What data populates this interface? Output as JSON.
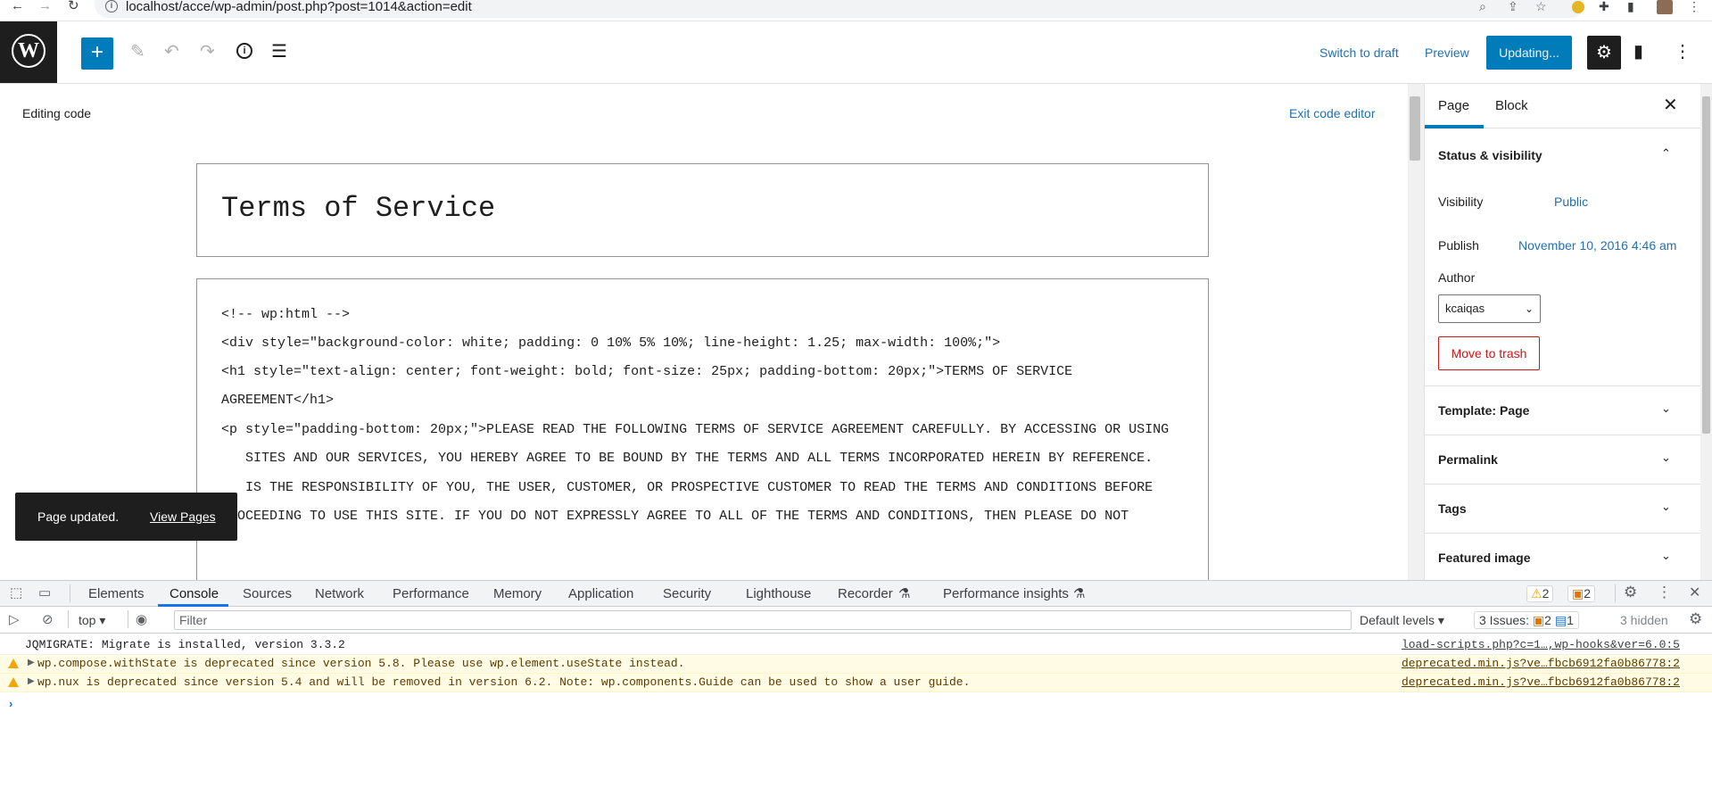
{
  "browser": {
    "url": "localhost/acce/wp-admin/post.php?post=1014&action=edit",
    "back_glyph": "←",
    "forward_glyph": "→",
    "reload_glyph": "↻",
    "info_glyph": "i",
    "zoom_glyph": "⌕",
    "share_glyph": "⇪",
    "star_glyph": "☆",
    "puzzle_glyph": "✚",
    "panel_glyph": "▮",
    "menu_glyph": "⋮"
  },
  "header": {
    "logo_glyph": "W",
    "add_glyph": "+",
    "edit_glyph": "✎",
    "undo_glyph": "↶",
    "redo_glyph": "↷",
    "info_glyph": "i",
    "outline_glyph": "☰",
    "switch_to_draft": "Switch to draft",
    "preview": "Preview",
    "update": "Updating...",
    "settings_glyph": "⚙",
    "plugin_glyph": "▮",
    "more_glyph": "⋮"
  },
  "editor": {
    "mode_label": "Editing code",
    "exit_label": "Exit code editor",
    "title": "Terms of Service",
    "code_lines": [
      "<!-- wp:html -->",
      "<div style=\"background-color: white; padding: 0 10% 5% 10%; line-height: 1.25; max-width: 100%;\">",
      "<h1 style=\"text-align: center; font-weight: bold; font-size: 25px; padding-bottom: 20px;\">TERMS OF SERVICE",
      "AGREEMENT</h1>",
      "<p style=\"padding-bottom: 20px;\">PLEASE READ THE FOLLOWING TERMS OF SERVICE AGREEMENT CAREFULLY. BY ACCESSING OR USING",
      "   SITES AND OUR SERVICES, YOU HEREBY AGREE TO BE BOUND BY THE TERMS AND ALL TERMS INCORPORATED HEREIN BY REFERENCE.",
      "   IS THE RESPONSIBILITY OF YOU, THE USER, CUSTOMER, OR PROSPECTIVE CUSTOMER TO READ THE TERMS AND CONDITIONS BEFORE",
      "PROCEEDING TO USE THIS SITE. IF YOU DO NOT EXPRESSLY AGREE TO ALL OF THE TERMS AND CONDITIONS, THEN PLEASE DO NOT"
    ]
  },
  "snackbar": {
    "message": "Page updated.",
    "link": "View Pages"
  },
  "sidebar": {
    "tabs": [
      "Page",
      "Block"
    ],
    "close_glyph": "✕",
    "status_section": "Status & visibility",
    "visibility_label": "Visibility",
    "visibility_value": "Public",
    "publish_label": "Publish",
    "publish_value": "November 10, 2016 4:46 am",
    "author_label": "Author",
    "author_value": "kcaiqas",
    "trash_label": "Move to trash",
    "collapsed_sections": [
      "Template: Page",
      "Permalink",
      "Tags",
      "Featured image"
    ],
    "chevron_up": "⌃",
    "chevron_down": "⌄"
  },
  "devtools": {
    "tabs": [
      "Elements",
      "Console",
      "Sources",
      "Network",
      "Performance",
      "Memory",
      "Application",
      "Security",
      "Lighthouse",
      "Recorder",
      "Performance insights"
    ],
    "flask_glyph": "⚗",
    "warn_count": "2",
    "note_count": "2",
    "context": "top",
    "filter_placeholder": "Filter",
    "default_levels": "Default levels",
    "issues_label": "3 Issues:",
    "issues_warn": "2",
    "issues_info": "1",
    "hidden": "3 hidden",
    "settings_glyph": "⚙",
    "menu_glyph": "⋮",
    "close_glyph": "✕",
    "prompt_glyph": "›",
    "messages": [
      {
        "text": "JQMIGRATE: Migrate is installed, version 3.3.2",
        "source": "load-scripts.php?c=1…,wp-hooks&ver=6.0:5",
        "level": "log"
      },
      {
        "text": "wp.compose.withState is deprecated since version 5.8. Please use wp.element.useState instead.",
        "source": "deprecated.min.js?ve…fbcb6912fa0b86778:2",
        "level": "warn"
      },
      {
        "text": "wp.nux is deprecated since version 5.4 and will be removed in version 6.2. Note: wp.components.Guide can be used to show a user guide.",
        "source": "deprecated.min.js?ve…fbcb6912fa0b86778:2",
        "level": "warn"
      }
    ]
  }
}
